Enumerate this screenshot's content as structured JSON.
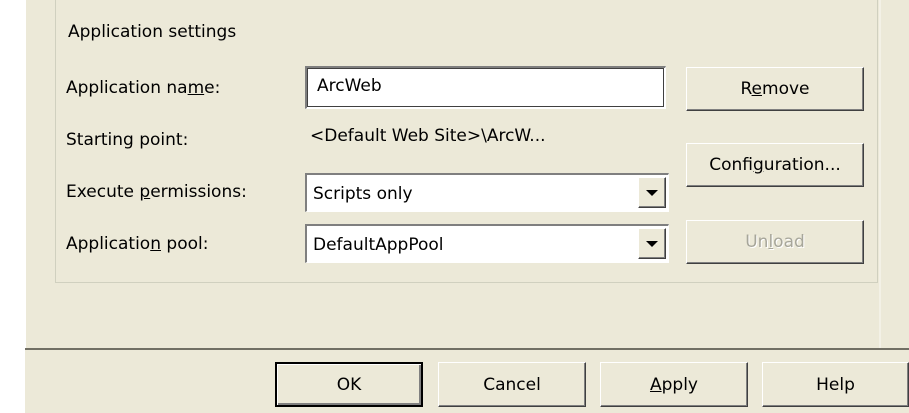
{
  "group": {
    "title": "Application settings"
  },
  "fields": {
    "app_name": {
      "label_pre": "Application na",
      "label_key": "m",
      "label_post": "e:",
      "value": "ArcWeb"
    },
    "starting_point": {
      "label": "Starting point:",
      "value": "<Default Web Site>\\ArcW..."
    },
    "execute_permissions": {
      "label_pre": "Execute ",
      "label_key": "p",
      "label_post": "ermissions:",
      "value": "Scripts only"
    },
    "app_pool": {
      "label_pre": "Applicatio",
      "label_key": "n",
      "label_post": " pool:",
      "value": "DefaultAppPool"
    }
  },
  "side_buttons": {
    "remove": {
      "pre": "R",
      "key": "e",
      "post": "move"
    },
    "configuration": {
      "pre": "Confi",
      "key": "g",
      "post": "uration..."
    },
    "unload": {
      "pre": "Un",
      "key": "l",
      "post": "oad"
    }
  },
  "dialog_buttons": {
    "ok": "OK",
    "cancel": "Cancel",
    "apply": {
      "key": "A",
      "post": "pply"
    },
    "help": "Help"
  }
}
